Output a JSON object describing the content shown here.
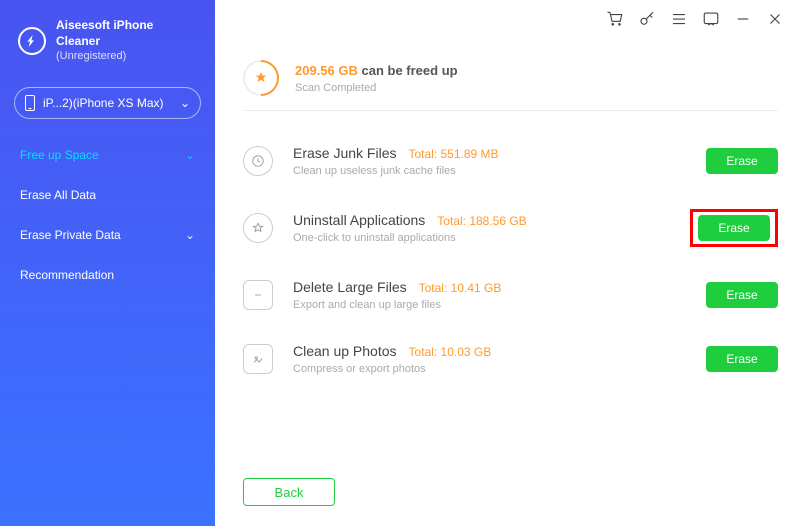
{
  "brand": {
    "title": "Aiseesoft iPhone Cleaner",
    "subtitle": "(Unregistered)"
  },
  "device": {
    "label": "iP...2)(iPhone XS Max)"
  },
  "sidebar": {
    "items": [
      {
        "label": "Free up Space",
        "has_chevron": true,
        "active": true
      },
      {
        "label": "Erase All Data",
        "has_chevron": false,
        "active": false
      },
      {
        "label": "Erase Private Data",
        "has_chevron": true,
        "active": false
      },
      {
        "label": "Recommendation",
        "has_chevron": false,
        "active": false
      }
    ]
  },
  "summary": {
    "size": "209.56 GB",
    "suffix": "can be freed up",
    "status": "Scan Completed"
  },
  "rows": [
    {
      "title": "Erase Junk Files",
      "total_label": "Total: 551.89 MB",
      "desc": "Clean up useless junk cache files",
      "button": "Erase",
      "icon": "clock",
      "highlight": false
    },
    {
      "title": "Uninstall Applications",
      "total_label": "Total: 188.56 GB",
      "desc": "One-click to uninstall applications",
      "button": "Erase",
      "icon": "star",
      "highlight": true
    },
    {
      "title": "Delete Large Files",
      "total_label": "Total: 10.41 GB",
      "desc": "Export and clean up large files",
      "button": "Erase",
      "icon": "doc",
      "highlight": false
    },
    {
      "title": "Clean up Photos",
      "total_label": "Total: 10.03 GB",
      "desc": "Compress or export photos",
      "button": "Erase",
      "icon": "image",
      "highlight": false
    }
  ],
  "back_label": "Back"
}
